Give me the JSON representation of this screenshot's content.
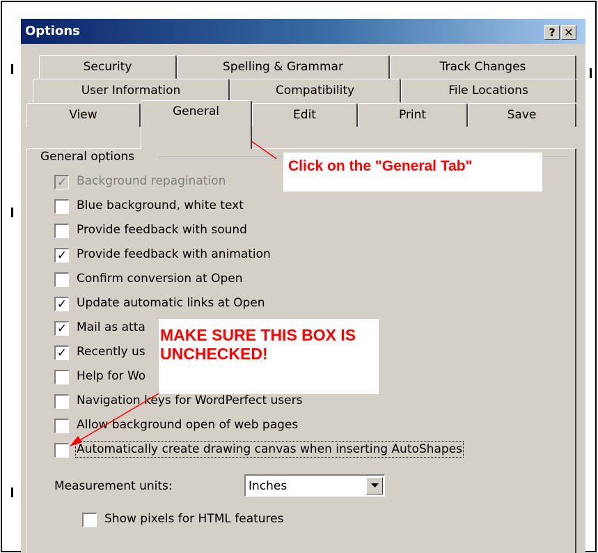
{
  "dialog": {
    "title": "Options",
    "help_button": "?",
    "close_button": "✕"
  },
  "tabs": {
    "row1": [
      "Security",
      "Spelling & Grammar",
      "Track Changes"
    ],
    "row2": [
      "User Information",
      "Compatibility",
      "File Locations"
    ],
    "row3": [
      "View",
      "General",
      "Edit",
      "Print",
      "Save"
    ],
    "active": "General"
  },
  "general": {
    "group_label": "General options",
    "options": [
      {
        "label": "Background repagination",
        "checked": true,
        "disabled": true
      },
      {
        "label": "Blue background, white text",
        "checked": false
      },
      {
        "label": "Provide feedback with sound",
        "checked": false
      },
      {
        "label": "Provide feedback with animation",
        "checked": true
      },
      {
        "label": "Confirm conversion at Open",
        "checked": false
      },
      {
        "label": "Update automatic links at Open",
        "checked": true
      },
      {
        "label": "Mail as atta",
        "checked": true
      },
      {
        "label": "Recently us",
        "checked": true
      },
      {
        "label": "Help for Wo",
        "checked": false
      },
      {
        "label": "Navigation keys for WordPerfect users",
        "checked": false
      },
      {
        "label": "Allow background open of web pages",
        "checked": false
      },
      {
        "label": "Automatically create drawing canvas when inserting AutoShapes",
        "checked": false
      }
    ],
    "measurement_label": "Measurement units:",
    "measurement_value": "Inches",
    "show_pixels_label": "Show pixels for HTML features",
    "show_pixels_checked": false
  },
  "annotations": {
    "callout_general": "Click on the \"General Tab\"",
    "callout_uncheck": "MAKE SURE THIS BOX IS UNCHECKED!",
    "color": "#ff0000"
  }
}
